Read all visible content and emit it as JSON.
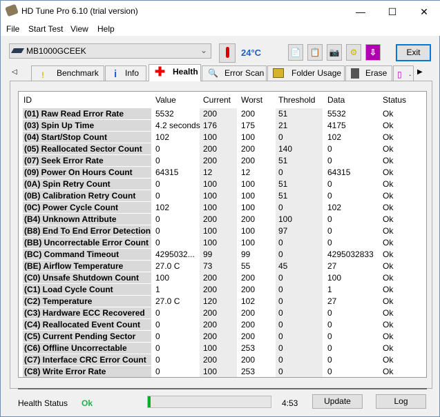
{
  "window": {
    "title": "HD Tune Pro 6.10 (trial version)",
    "minimize": "—",
    "maximize": "☐",
    "close": "✕"
  },
  "menu": [
    "File",
    "Start Test",
    "View",
    "Help"
  ],
  "toolbar": {
    "drive": "MB1000GCEEK",
    "temperature": "24°C",
    "exit": "Exit"
  },
  "tabs": [
    "Benchmark",
    "Info",
    "Health",
    "Error Scan",
    "Folder Usage",
    "Erase",
    "."
  ],
  "active_tab": "Health",
  "table": {
    "headers": [
      "ID",
      "Value",
      "Current",
      "Worst",
      "Threshold",
      "Data",
      "Status"
    ],
    "rows": [
      [
        "(01) Raw Read Error Rate",
        "5532",
        "200",
        "200",
        "51",
        "5532",
        "Ok"
      ],
      [
        "(03) Spin Up Time",
        "4.2 seconds",
        "176",
        "175",
        "21",
        "4175",
        "Ok"
      ],
      [
        "(04) Start/Stop Count",
        "102",
        "100",
        "100",
        "0",
        "102",
        "Ok"
      ],
      [
        "(05) Reallocated Sector Count",
        "0",
        "200",
        "200",
        "140",
        "0",
        "Ok"
      ],
      [
        "(07) Seek Error Rate",
        "0",
        "200",
        "200",
        "51",
        "0",
        "Ok"
      ],
      [
        "(09) Power On Hours Count",
        "64315",
        "12",
        "12",
        "0",
        "64315",
        "Ok"
      ],
      [
        "(0A) Spin Retry Count",
        "0",
        "100",
        "100",
        "51",
        "0",
        "Ok"
      ],
      [
        "(0B) Calibration Retry Count",
        "0",
        "100",
        "100",
        "51",
        "0",
        "Ok"
      ],
      [
        "(0C) Power Cycle Count",
        "102",
        "100",
        "100",
        "0",
        "102",
        "Ok"
      ],
      [
        "(B4) Unknown Attribute",
        "0",
        "200",
        "200",
        "100",
        "0",
        "Ok"
      ],
      [
        "(B8) End To End Error Detection",
        "0",
        "100",
        "100",
        "97",
        "0",
        "Ok"
      ],
      [
        "(BB) Uncorrectable Error Count",
        "0",
        "100",
        "100",
        "0",
        "0",
        "Ok"
      ],
      [
        "(BC) Command Timeout",
        "4295032...",
        "99",
        "99",
        "0",
        "4295032833",
        "Ok"
      ],
      [
        "(BE) Airflow Temperature",
        "27.0 C",
        "73",
        "55",
        "45",
        "27",
        "Ok"
      ],
      [
        "(C0) Unsafe Shutdown Count",
        "100",
        "200",
        "200",
        "0",
        "100",
        "Ok"
      ],
      [
        "(C1) Load Cycle Count",
        "1",
        "200",
        "200",
        "0",
        "1",
        "Ok"
      ],
      [
        "(C2) Temperature",
        "27.0 C",
        "120",
        "102",
        "0",
        "27",
        "Ok"
      ],
      [
        "(C3) Hardware ECC Recovered",
        "0",
        "200",
        "200",
        "0",
        "0",
        "Ok"
      ],
      [
        "(C4) Reallocated Event Count",
        "0",
        "200",
        "200",
        "0",
        "0",
        "Ok"
      ],
      [
        "(C5) Current Pending Sector",
        "0",
        "200",
        "200",
        "0",
        "0",
        "Ok"
      ],
      [
        "(C6) Offline Uncorrectable",
        "0",
        "100",
        "253",
        "0",
        "0",
        "Ok"
      ],
      [
        "(C7) Interface CRC Error Count",
        "0",
        "200",
        "200",
        "0",
        "0",
        "Ok"
      ],
      [
        "(C8) Write Error Rate",
        "0",
        "100",
        "253",
        "0",
        "0",
        "Ok"
      ]
    ]
  },
  "status": {
    "label": "Health Status",
    "value": "Ok",
    "value_color": "#22b14c",
    "progress_percent": 2,
    "time": "4:53",
    "update": "Update",
    "log": "Log"
  }
}
